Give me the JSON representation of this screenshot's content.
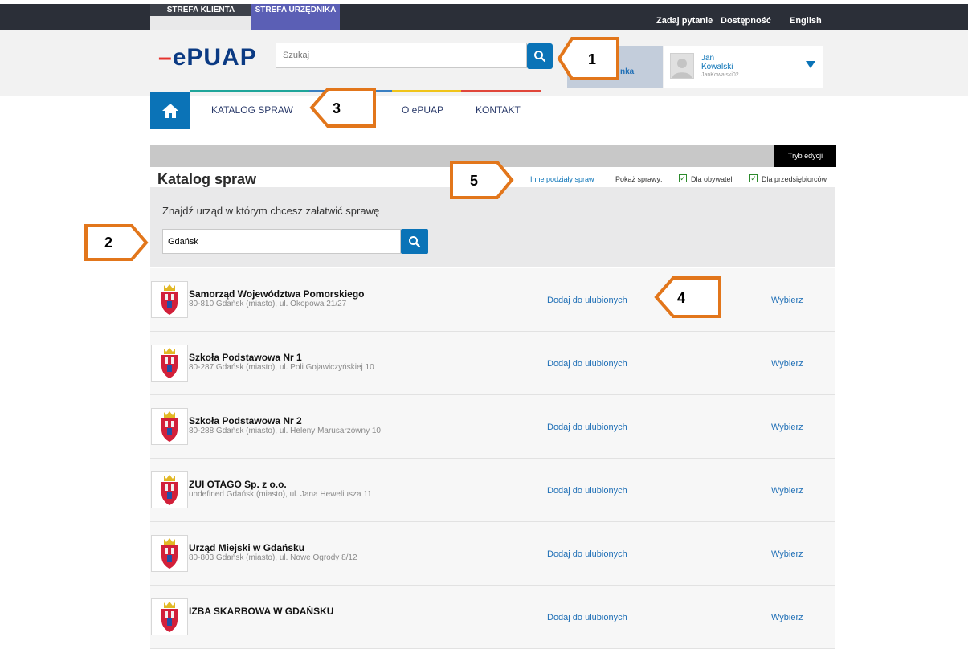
{
  "top_bar": {
    "tab_client": "STREFA KLIENTA",
    "tab_clerk": "STREFA URZĘDNIKA",
    "links": [
      "Zadaj pytanie",
      "Dostępność",
      "English"
    ]
  },
  "header": {
    "logo": "ePUAP",
    "search_placeholder": "Szukaj",
    "login_partial": "nka",
    "user": {
      "first": "Jan",
      "last": "Kowalski",
      "login": "JanKowalski02"
    }
  },
  "nav": {
    "items": [
      "KATALOG SPRAW",
      "O ePUAP",
      "KONTAKT"
    ]
  },
  "catalog": {
    "edit_mode": "Tryb edycji",
    "title": "Katalog spraw",
    "other_divisions": "Inne podziały spraw",
    "show_label": "Pokaż sprawy:",
    "filter_citizens": "Dla obywateli",
    "filter_business": "Dla przedsiębiorców",
    "search_label": "Znajdź urząd w którym chcesz załatwić sprawę",
    "search_value": "Gdańsk",
    "results": [
      {
        "name": "Samorząd Województwa Pomorskiego",
        "address": "80-810 Gdańsk (miasto), ul. Okopowa 21/27",
        "favorite": "Dodaj do ulubionych",
        "choose": "Wybierz"
      },
      {
        "name": "Szkoła Podstawowa Nr 1",
        "address": "80-287 Gdańsk (miasto), ul. Poli Gojawiczyńskiej 10",
        "favorite": "Dodaj do ulubionych",
        "choose": "Wybierz"
      },
      {
        "name": "Szkoła Podstawowa Nr 2",
        "address": "80-288 Gdańsk (miasto), ul. Heleny Marusarzówny 10",
        "favorite": "Dodaj do ulubionych",
        "choose": "Wybierz"
      },
      {
        "name": "ZUI OTAGO Sp. z o.o.",
        "address": "undefined Gdańsk (miasto), ul. Jana Heweliusza 11",
        "favorite": "Dodaj do ulubionych",
        "choose": "Wybierz"
      },
      {
        "name": "Urząd Miejski w Gdańsku",
        "address": "80-803 Gdańsk (miasto), ul. Nowe Ogrody 8/12",
        "favorite": "Dodaj do ulubionych",
        "choose": "Wybierz"
      },
      {
        "name": "IZBA SKARBOWA W GDAŃSKU",
        "address": "",
        "favorite": "Dodaj do ulubionych",
        "choose": "Wybierz"
      }
    ]
  },
  "callouts": [
    "1",
    "2",
    "3",
    "4",
    "5"
  ],
  "colors": {
    "primary": "#0a73b7",
    "callout": "#e2761b",
    "topbar": "#2b2f38",
    "clerk_tab": "#5b5fb5"
  }
}
